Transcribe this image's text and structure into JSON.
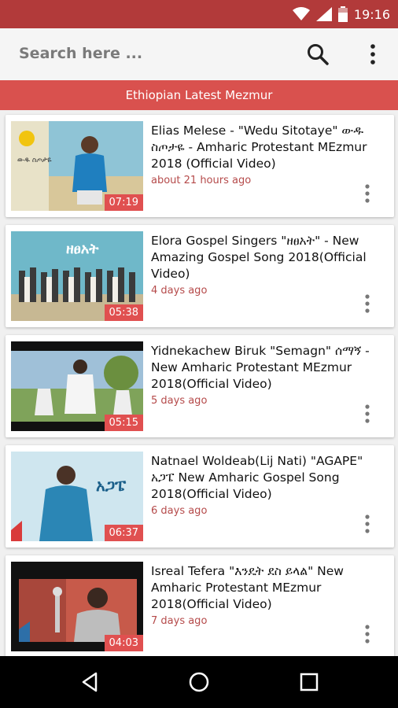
{
  "status": {
    "time": "19:16"
  },
  "search": {
    "placeholder": "Search here ..."
  },
  "banner": {
    "title": "Ethiopian Latest Mezmur"
  },
  "videos": [
    {
      "title": "Elias Melese - \"Wedu Sitotaye\" ውዱ ስጦታዬ - Amharic Protestant MEzmur 2018 (Official Video)",
      "age": "about 21 hours ago",
      "duration": "07:19"
    },
    {
      "title": "Elora Gospel Singers \"ዘፀአት\" - New Amazing Gospel Song 2018(Official Video)",
      "age": "4 days ago",
      "duration": "05:38"
    },
    {
      "title": "Yidnekachew Biruk \"Semagn\" ሰማኝ - New Amharic Protestant MEzmur 2018(Official Video)",
      "age": "5 days ago",
      "duration": "05:15"
    },
    {
      "title": "Natnael Woldeab(Lij Nati) \"AGAPE\" አጋፔ New Amharic Gospel Song 2018(Official Video)",
      "age": "6 days ago",
      "duration": "06:37"
    },
    {
      "title": "Isreal Tefera \"እንዴት ደስ ይላል\" New Amharic Protestant MEzmur 2018(Official Video)",
      "age": "7 days ago",
      "duration": "04:03"
    }
  ],
  "thumbnails": {
    "0": {
      "caption": "ውዱ ስጦታዬ"
    },
    "1": {
      "caption": "ዘፀአት"
    },
    "3": {
      "caption": "አጋፔ"
    }
  }
}
